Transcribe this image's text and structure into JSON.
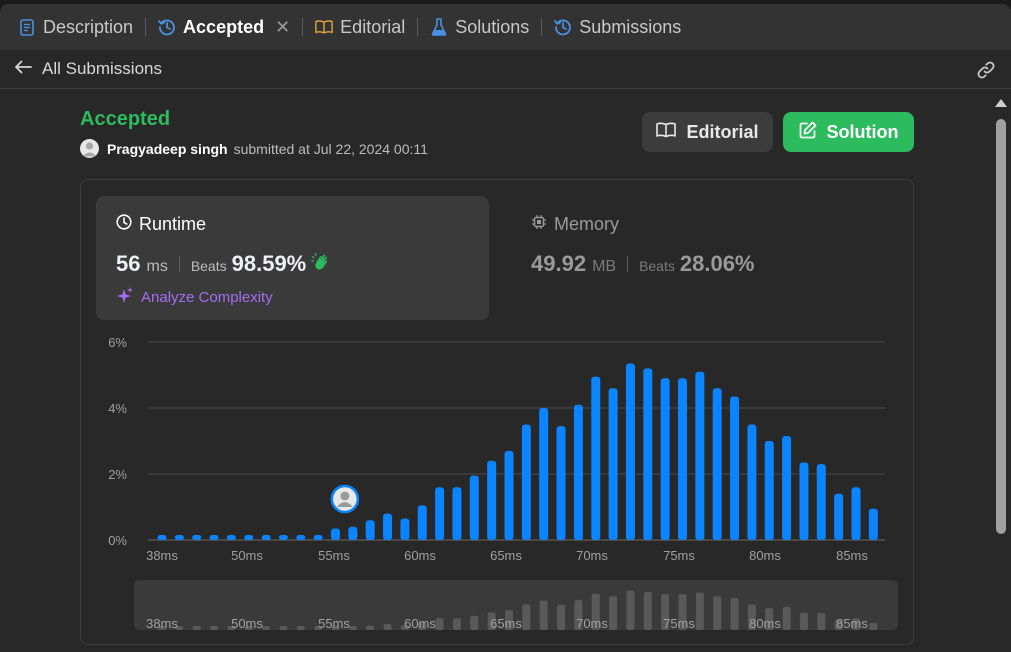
{
  "tabs": [
    {
      "label": "Description",
      "icon": "description-icon",
      "active": false
    },
    {
      "label": "Accepted",
      "icon": "history-icon",
      "active": true
    },
    {
      "label": "Editorial",
      "icon": "book-icon",
      "active": false
    },
    {
      "label": "Solutions",
      "icon": "flask-icon",
      "active": false
    },
    {
      "label": "Submissions",
      "icon": "history-icon",
      "active": false
    }
  ],
  "nav": {
    "back_label": "All Submissions"
  },
  "submission": {
    "status": "Accepted",
    "user": "Pragyadeep singh",
    "submitted_text": "submitted at Jul 22, 2024 00:11"
  },
  "buttons": {
    "editorial": "Editorial",
    "solution": "Solution"
  },
  "runtime": {
    "title": "Runtime",
    "value": "56",
    "unit": "ms",
    "beats_label": "Beats",
    "beats": "98.59%",
    "analyze_label": "Analyze Complexity"
  },
  "memory": {
    "title": "Memory",
    "value": "49.92",
    "unit": "MB",
    "beats_label": "Beats",
    "beats": "28.06%"
  },
  "colors": {
    "accent_green": "#2cbb5d",
    "bar_blue": "#0a84ff",
    "analyze_purple": "#a56cf2"
  },
  "chart_data": {
    "type": "bar",
    "y_ticks": [
      "6%",
      "4%",
      "2%",
      "0%"
    ],
    "ylim": [
      0,
      6
    ],
    "x_ticks": [
      "38ms",
      "50ms",
      "55ms",
      "60ms",
      "65ms",
      "70ms",
      "75ms",
      "80ms",
      "85ms"
    ],
    "values": [
      0.15,
      0.15,
      0.15,
      0.15,
      0.15,
      0.15,
      0.15,
      0.15,
      0.15,
      0.15,
      0.35,
      0.4,
      0.6,
      0.8,
      0.65,
      1.05,
      1.6,
      1.6,
      1.95,
      2.4,
      2.7,
      3.5,
      4.0,
      3.45,
      4.1,
      4.95,
      4.6,
      5.35,
      5.2,
      4.9,
      4.9,
      5.1,
      4.6,
      4.35,
      3.5,
      3.0,
      3.15,
      2.35,
      2.3,
      1.4,
      1.6,
      0.95
    ],
    "highlight_index": 11,
    "grid": true
  }
}
